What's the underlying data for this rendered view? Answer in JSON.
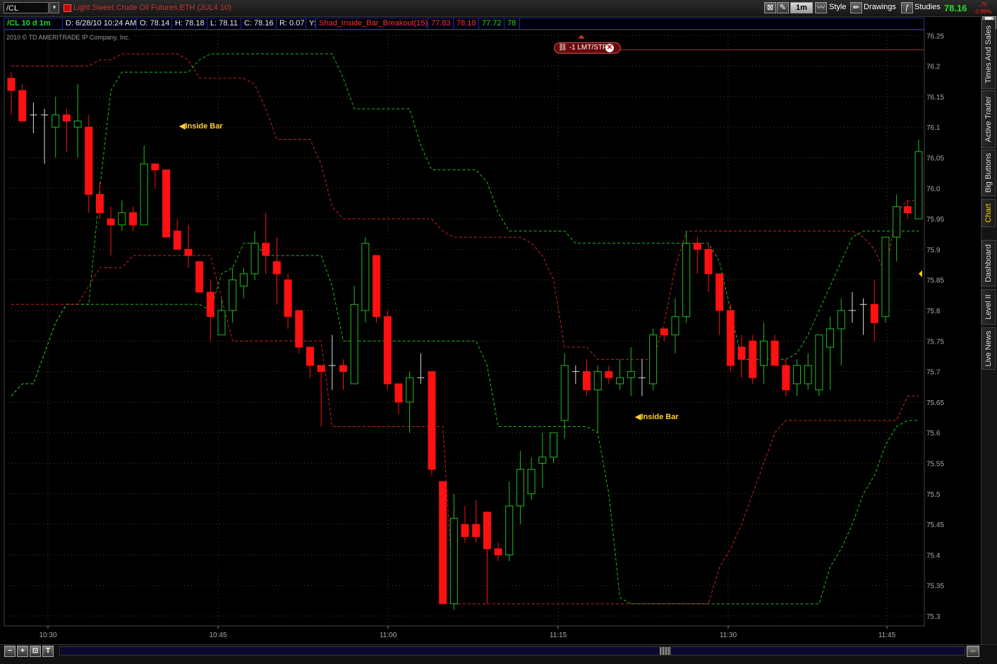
{
  "titlebar": {
    "symbol": "/CL",
    "title": "Light Sweet Crude Oil Futures,ETH (JUL4 10)",
    "timeframe": "1m",
    "style_label": "Style",
    "drawings_label": "Drawings",
    "studies_label": "Studies",
    "last_price": "78.16",
    "change": ".70",
    "change_pct": "-0.89%"
  },
  "infobar": {
    "chart_id": "/CL 10 d 1m",
    "date": "D: 6/28/10 10:24 AM",
    "open": "O: 78.14",
    "high": "H: 78.18",
    "low": "L: 78.11",
    "close": "C: 78.16",
    "range": "R: 0.07",
    "y_label": "Y:",
    "study_name": "Shad_Inside_Bar_Breakout(15)",
    "study_v1": "77.83",
    "study_v2": "78.18",
    "study_v3": "77.72",
    "study_v4": "78"
  },
  "copyright": "2010 © TD AMERITRADE IP Company, Inc.",
  "order": {
    "label": "-1 LMT/STP",
    "price": 76.23
  },
  "annotations": [
    {
      "text": "Inside Bar"
    },
    {
      "text": "Inside Bar"
    }
  ],
  "sidebar_tabs": [
    "Times And Sales",
    "Active Trader",
    "Big Buttons",
    "Chart",
    "Dashboard",
    "Level II",
    "Live News"
  ],
  "colors": {
    "up": "#22bb22",
    "down": "#ff1111",
    "upper_line": "#cc2222",
    "lower_line": "#22bb22",
    "grid": "#5a3a1a",
    "annotation": "#ffcc33"
  },
  "chart_data": {
    "type": "candlestick",
    "title": "",
    "xlabel": "",
    "ylabel": "",
    "ylim": [
      75.28,
      76.26
    ],
    "y_ticks": [
      75.3,
      75.35,
      75.4,
      75.45,
      75.5,
      75.55,
      75.6,
      75.65,
      75.7,
      75.75,
      75.8,
      75.85,
      75.9,
      75.95,
      76.0,
      76.05,
      76.1,
      76.15,
      76.2,
      76.25
    ],
    "x_ticks": [
      "10:30",
      "10:45",
      "11:00",
      "11:15",
      "11:30",
      "11:45"
    ],
    "candles": [
      [
        76.18,
        76.16,
        76.19,
        76.12
      ],
      [
        76.16,
        76.11,
        76.17,
        76.11
      ],
      [
        76.12,
        76.12,
        76.14,
        76.09
      ],
      [
        76.12,
        76.12,
        76.13,
        76.04
      ],
      [
        76.1,
        76.12,
        76.15,
        76.05
      ],
      [
        76.12,
        76.11,
        76.13,
        76.06
      ],
      [
        76.1,
        76.11,
        76.17,
        76.05
      ],
      [
        76.1,
        75.99,
        76.12,
        75.96
      ],
      [
        75.99,
        75.96,
        76.01,
        75.95
      ],
      [
        75.95,
        75.94,
        75.97,
        75.89
      ],
      [
        75.94,
        75.96,
        75.98,
        75.93
      ],
      [
        75.96,
        75.94,
        75.97,
        75.93
      ],
      [
        75.94,
        76.04,
        76.07,
        75.94
      ],
      [
        76.04,
        76.03,
        76.04,
        76.0
      ],
      [
        76.03,
        75.92,
        76.03,
        75.92
      ],
      [
        75.93,
        75.9,
        75.95,
        75.9
      ],
      [
        75.9,
        75.89,
        75.94,
        75.87
      ],
      [
        75.88,
        75.83,
        75.88,
        75.83
      ],
      [
        75.83,
        75.79,
        75.85,
        75.75
      ],
      [
        75.76,
        75.8,
        75.82,
        75.76
      ],
      [
        75.8,
        75.85,
        75.87,
        75.78
      ],
      [
        75.84,
        75.86,
        75.87,
        75.82
      ],
      [
        75.86,
        75.91,
        75.93,
        75.85
      ],
      [
        75.91,
        75.89,
        75.96,
        75.86
      ],
      [
        75.88,
        75.86,
        75.92,
        75.81
      ],
      [
        75.85,
        75.79,
        75.86,
        75.77
      ],
      [
        75.8,
        75.74,
        75.8,
        75.73
      ],
      [
        75.74,
        75.71,
        75.74,
        75.69
      ],
      [
        75.71,
        75.7,
        75.71,
        75.61
      ],
      [
        75.71,
        75.71,
        75.76,
        75.67
      ],
      [
        75.71,
        75.7,
        75.72,
        75.67
      ],
      [
        75.68,
        75.81,
        75.84,
        75.68
      ],
      [
        75.8,
        75.91,
        75.92,
        75.78
      ],
      [
        75.89,
        75.79,
        75.89,
        75.78
      ],
      [
        75.79,
        75.68,
        75.8,
        75.67
      ],
      [
        75.68,
        75.65,
        75.68,
        75.63
      ],
      [
        75.65,
        75.69,
        75.7,
        75.6
      ],
      [
        75.69,
        75.69,
        75.73,
        75.68
      ],
      [
        75.7,
        75.54,
        75.7,
        75.53
      ],
      [
        75.52,
        75.32,
        75.52,
        75.32
      ],
      [
        75.32,
        75.46,
        75.5,
        75.31
      ],
      [
        75.45,
        75.43,
        75.48,
        75.42
      ],
      [
        75.45,
        75.43,
        75.49,
        75.42
      ],
      [
        75.47,
        75.41,
        75.47,
        75.32
      ],
      [
        75.41,
        75.4,
        75.42,
        75.39
      ],
      [
        75.4,
        75.48,
        75.52,
        75.39
      ],
      [
        75.48,
        75.54,
        75.57,
        75.45
      ],
      [
        75.5,
        75.54,
        75.56,
        75.49
      ],
      [
        75.55,
        75.56,
        75.6,
        75.51
      ],
      [
        75.56,
        75.6,
        75.6,
        75.55
      ],
      [
        75.62,
        75.71,
        75.73,
        75.59
      ],
      [
        75.7,
        75.7,
        75.71,
        75.68
      ],
      [
        75.7,
        75.67,
        75.72,
        75.66
      ],
      [
        75.67,
        75.7,
        75.71,
        75.6
      ],
      [
        75.7,
        75.69,
        75.71,
        75.68
      ],
      [
        75.68,
        75.69,
        75.72,
        75.67
      ],
      [
        75.69,
        75.7,
        75.74,
        75.66
      ],
      [
        75.69,
        75.69,
        75.72,
        75.66
      ],
      [
        75.68,
        75.76,
        75.77,
        75.67
      ],
      [
        75.77,
        75.76,
        75.77,
        75.75
      ],
      [
        75.76,
        75.79,
        75.82,
        75.73
      ],
      [
        75.79,
        75.91,
        75.93,
        75.78
      ],
      [
        75.91,
        75.9,
        75.92,
        75.86
      ],
      [
        75.9,
        75.86,
        75.91,
        75.83
      ],
      [
        75.86,
        75.8,
        75.86,
        75.76
      ],
      [
        75.8,
        75.71,
        75.81,
        75.7
      ],
      [
        75.74,
        75.72,
        75.76,
        75.69
      ],
      [
        75.75,
        75.69,
        75.76,
        75.68
      ],
      [
        75.71,
        75.75,
        75.78,
        75.68
      ],
      [
        75.75,
        75.71,
        75.76,
        75.71
      ],
      [
        75.71,
        75.67,
        75.72,
        75.66
      ],
      [
        75.68,
        75.71,
        75.72,
        75.66
      ],
      [
        75.68,
        75.71,
        75.73,
        75.67
      ],
      [
        75.67,
        75.76,
        75.76,
        75.66
      ],
      [
        75.74,
        75.77,
        75.79,
        75.67
      ],
      [
        75.77,
        75.8,
        75.82,
        75.71
      ],
      [
        75.8,
        75.8,
        75.83,
        75.78
      ],
      [
        75.81,
        75.81,
        75.82,
        75.76
      ],
      [
        75.81,
        75.78,
        75.85,
        75.75
      ],
      [
        75.79,
        75.92,
        75.92,
        75.78
      ],
      [
        75.92,
        75.97,
        75.99,
        75.88
      ],
      [
        75.97,
        75.96,
        75.98,
        75.95
      ],
      [
        75.95,
        76.06,
        76.08,
        75.95
      ]
    ],
    "upper_line": [
      76.2,
      76.2,
      76.2,
      76.2,
      76.2,
      76.2,
      76.2,
      76.2,
      76.21,
      76.21,
      76.22,
      76.22,
      76.22,
      76.22,
      76.22,
      76.22,
      76.21,
      76.18,
      76.18,
      76.18,
      76.18,
      76.18,
      76.17,
      76.13,
      76.08,
      76.08,
      76.08,
      76.08,
      76.04,
      75.97,
      75.95,
      75.95,
      75.95,
      75.95,
      75.95,
      75.95,
      75.95,
      75.95,
      75.95,
      75.93,
      75.92,
      75.92,
      75.92,
      75.92,
      75.92,
      75.92,
      75.92,
      75.91,
      75.89,
      75.85,
      75.74,
      75.74,
      75.74,
      75.72,
      75.72,
      75.72,
      75.72,
      75.72,
      75.72,
      75.78,
      75.87,
      75.93,
      75.93,
      75.93,
      75.93,
      75.93,
      75.93,
      75.93,
      75.93,
      75.93,
      75.93,
      75.93,
      75.93,
      75.93,
      75.93,
      75.93,
      75.93,
      75.92,
      75.9,
      75.86,
      75.96,
      75.98,
      75.98
    ],
    "lower_line": [
      75.81,
      75.81,
      75.81,
      75.81,
      75.81,
      75.81,
      75.81,
      75.84,
      75.87,
      75.87,
      75.87,
      75.89,
      75.89,
      75.89,
      75.89,
      75.89,
      75.89,
      75.89,
      75.89,
      75.82,
      75.75,
      75.75,
      75.75,
      75.75,
      75.75,
      75.75,
      75.75,
      75.75,
      75.75,
      75.61,
      75.61,
      75.61,
      75.61,
      75.61,
      75.61,
      75.61,
      75.61,
      75.61,
      75.61,
      75.61,
      75.32,
      75.32,
      75.32,
      75.32,
      75.32,
      75.32,
      75.32,
      75.32,
      75.32,
      75.32,
      75.32,
      75.32,
      75.32,
      75.32,
      75.32,
      75.32,
      75.32,
      75.32,
      75.32,
      75.32,
      75.32,
      75.32,
      75.32,
      75.32,
      75.38,
      75.41,
      75.45,
      75.5,
      75.55,
      75.6,
      75.62,
      75.62,
      75.62,
      75.62,
      75.62,
      75.62,
      75.62,
      75.62,
      75.62,
      75.62,
      75.62,
      75.66,
      75.66
    ],
    "green_dashed": [
      75.66,
      75.68,
      75.68,
      75.73,
      75.78,
      75.81,
      75.81,
      75.81,
      76.0,
      76.16,
      76.19,
      76.19,
      76.19,
      76.19,
      76.19,
      76.19,
      76.19,
      76.21,
      76.22,
      76.22,
      76.22,
      76.22,
      76.22,
      76.22,
      76.22,
      76.22,
      76.22,
      76.22,
      76.22,
      76.22,
      76.18,
      76.13,
      76.13,
      76.13,
      76.13,
      76.13,
      76.13,
      76.07,
      76.03,
      76.03,
      76.03,
      76.03,
      76.03,
      76.01,
      75.96,
      75.93,
      75.93,
      75.93,
      75.93,
      75.93,
      75.93,
      75.91,
      75.91,
      75.91,
      75.91,
      75.91,
      75.91,
      75.91,
      75.91,
      75.91,
      75.91,
      75.91,
      75.91,
      75.91,
      75.88,
      75.8,
      75.72,
      75.72,
      75.72,
      75.72,
      75.72,
      75.73,
      75.76,
      75.8,
      75.84,
      75.88,
      75.92,
      75.93,
      75.93,
      75.93,
      75.93,
      75.93,
      75.93
    ],
    "green_dashed_low": [
      75.66,
      75.68,
      75.68,
      75.73,
      75.78,
      75.81,
      75.81,
      75.81,
      75.81,
      75.81,
      75.81,
      75.81,
      75.81,
      75.81,
      75.81,
      75.81,
      75.81,
      75.81,
      75.8,
      75.86,
      75.87,
      75.91,
      75.91,
      75.89,
      75.89,
      75.89,
      75.89,
      75.89,
      75.89,
      75.84,
      75.75,
      75.75,
      75.75,
      75.75,
      75.75,
      75.75,
      75.75,
      75.75,
      75.75,
      75.75,
      75.75,
      75.75,
      75.75,
      75.71,
      75.61,
      75.61,
      75.61,
      75.61,
      75.61,
      75.61,
      75.61,
      75.61,
      75.61,
      75.6,
      75.5,
      75.33,
      75.32,
      75.32,
      75.32,
      75.32,
      75.32,
      75.32,
      75.32,
      75.32,
      75.32,
      75.32,
      75.32,
      75.32,
      75.32,
      75.32,
      75.32,
      75.32,
      75.32,
      75.32,
      75.38,
      75.41,
      75.45,
      75.5,
      75.53,
      75.58,
      75.61,
      75.62,
      75.62
    ]
  }
}
